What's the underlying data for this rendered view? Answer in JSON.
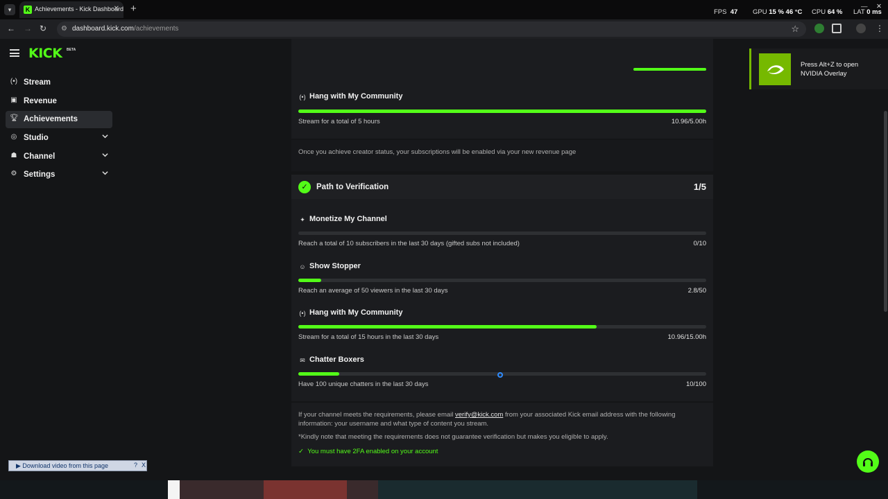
{
  "browser": {
    "tab_title": "Achievements - Kick Dashboard",
    "tab_favicon": "K",
    "url_host": "dashboard.kick.com",
    "url_path": "/achievements"
  },
  "perf_overlay": {
    "fps_label": "FPS",
    "fps_value": "47",
    "gpu_label": "GPU",
    "gpu_value": "15 %",
    "gpu_temp": "46 °C",
    "cpu_label": "CPU",
    "cpu_value": "64 %",
    "lat_label": "LAT",
    "lat_value": "0 ms"
  },
  "header": {
    "logo": "KICK",
    "logo_badge": "BETA"
  },
  "sidebar": {
    "items": [
      {
        "label": "Stream",
        "icon": "broadcast-icon"
      },
      {
        "label": "Revenue",
        "icon": "revenue-icon"
      },
      {
        "label": "Achievements",
        "icon": "trophy-icon",
        "active": true
      },
      {
        "label": "Studio",
        "icon": "studio-icon",
        "expandable": true
      },
      {
        "label": "Channel",
        "icon": "channel-icon",
        "expandable": true
      },
      {
        "label": "Settings",
        "icon": "gear-icon",
        "expandable": true
      }
    ]
  },
  "creator_section": {
    "hang": {
      "title": "Hang with My Community",
      "description": "Stream for a total of 5 hours",
      "progress_text": "10.96/5.00h",
      "progress_fraction": 1.0
    },
    "note": "Once you achieve creator status, your subscriptions will be enabled via your new revenue page"
  },
  "verification": {
    "title": "Path to Verification",
    "count": "1/5",
    "achievements": [
      {
        "title": "Monetize My Channel",
        "icon": "sparkle-icon",
        "description": "Reach a total of 10 subscribers in the last 30 days (gifted subs not included)",
        "progress_text": "0/10",
        "progress_fraction": 0.0
      },
      {
        "title": "Show Stopper",
        "icon": "users-icon",
        "description": "Reach an average of 50 viewers in the last 30 days",
        "progress_text": "2.8/50",
        "progress_fraction": 0.056
      },
      {
        "title": "Hang with My Community",
        "icon": "broadcast-icon",
        "description": "Stream for a total of 15 hours in the last 30 days",
        "progress_text": "10.96/15.00h",
        "progress_fraction": 0.731
      },
      {
        "title": "Chatter Boxers",
        "icon": "chat-icon",
        "description": "Have 100 unique chatters in the last 30 days",
        "progress_text": "10/100",
        "progress_fraction": 0.1
      }
    ],
    "email_note_before": "If your channel meets the requirements, please email ",
    "email_link": "verify@kick.com",
    "email_note_after": " from your associated Kick email address with the following",
    "email_note_line2": "information: your username and what type of content you stream.",
    "disclaimer": "*Kindly note that meeting the requirements does not guarantee verification but makes you eligible to apply.",
    "requirement_2fa": "You must have 2FA enabled on your account"
  },
  "nvidia_toast": {
    "text_line1": "Press Alt+Z to open",
    "text_line2": "NVIDIA Overlay"
  },
  "download_bar": {
    "label": "Download video from this page",
    "help": "?",
    "close": "X"
  },
  "colors": {
    "accent": "#53fc18",
    "background": "#141517",
    "card": "#1b1c1f",
    "track": "#2e3033",
    "nvidia": "#76b900"
  }
}
